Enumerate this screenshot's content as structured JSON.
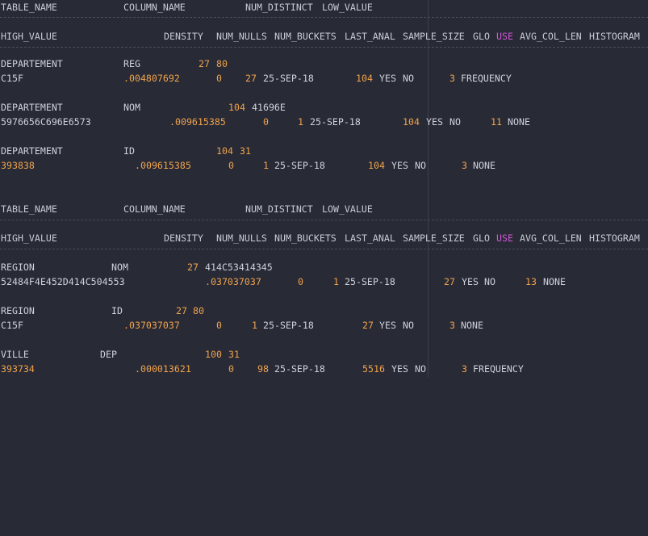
{
  "header1": {
    "cols": [
      "TABLE_NAME",
      "COLUMN_NAME",
      "NUM_DISTINCT",
      "LOW_VALUE"
    ]
  },
  "header2": {
    "cols": [
      "HIGH_VALUE",
      "DENSITY",
      "NUM_NULLS",
      "NUM_BUCKETS",
      "LAST_ANAL",
      "SAMPLE_SIZE",
      "GLO",
      "USE",
      "AVG_COL_LEN",
      "HISTOGRAM"
    ]
  },
  "rows": [
    {
      "table_name": "DEPARTEMENT",
      "column_name": "REG",
      "num_distinct": "27",
      "low_value": "80",
      "high_value": "C15F",
      "density": ".004807692",
      "num_nulls": "0",
      "num_buckets": "27",
      "last_anal": "25-SEP-18",
      "sample_size": "104",
      "glo": "YES",
      "use": "NO",
      "avg_col_len": "3",
      "histogram": "FREQUENCY"
    },
    {
      "table_name": "DEPARTEMENT",
      "column_name": "NOM",
      "num_distinct": "104",
      "low_value": "41696E",
      "high_value": "5976656C696E6573",
      "density": ".009615385",
      "num_nulls": "0",
      "num_buckets": "1",
      "last_anal": "25-SEP-18",
      "sample_size": "104",
      "glo": "YES",
      "use": "NO",
      "avg_col_len": "11",
      "histogram": "NONE"
    },
    {
      "table_name": "DEPARTEMENT",
      "column_name": "ID",
      "num_distinct": "104",
      "low_value": "31",
      "high_value": "393838",
      "density": ".009615385",
      "num_nulls": "0",
      "num_buckets": "1",
      "last_anal": "25-SEP-18",
      "sample_size": "104",
      "glo": "YES",
      "use": "NO",
      "avg_col_len": "3",
      "histogram": "NONE"
    },
    {
      "table_name": "REGION",
      "column_name": "NOM",
      "num_distinct": "27",
      "low_value": "414C53414345",
      "high_value": "52484F4E452D414C504553",
      "density": ".037037037",
      "num_nulls": "0",
      "num_buckets": "1",
      "last_anal": "25-SEP-18",
      "sample_size": "27",
      "glo": "YES",
      "use": "NO",
      "avg_col_len": "13",
      "histogram": "NONE"
    },
    {
      "table_name": "REGION",
      "column_name": "ID",
      "num_distinct": "27",
      "low_value": "80",
      "high_value": "C15F",
      "density": ".037037037",
      "num_nulls": "0",
      "num_buckets": "1",
      "last_anal": "25-SEP-18",
      "sample_size": "27",
      "glo": "YES",
      "use": "NO",
      "avg_col_len": "3",
      "histogram": "NONE"
    },
    {
      "table_name": "VILLE",
      "column_name": "DEP",
      "num_distinct": "100",
      "low_value": "31",
      "high_value": "393734",
      "density": ".000013621",
      "num_nulls": "0",
      "num_buckets": "98",
      "last_anal": "25-SEP-18",
      "sample_size": "5516",
      "glo": "YES",
      "use": "NO",
      "avg_col_len": "3",
      "histogram": "FREQUENCY"
    }
  ],
  "colors": {
    "background": "#282a36",
    "text": "#cfd2dc",
    "number": "#f0a34c",
    "keyword": "#d057d6"
  }
}
